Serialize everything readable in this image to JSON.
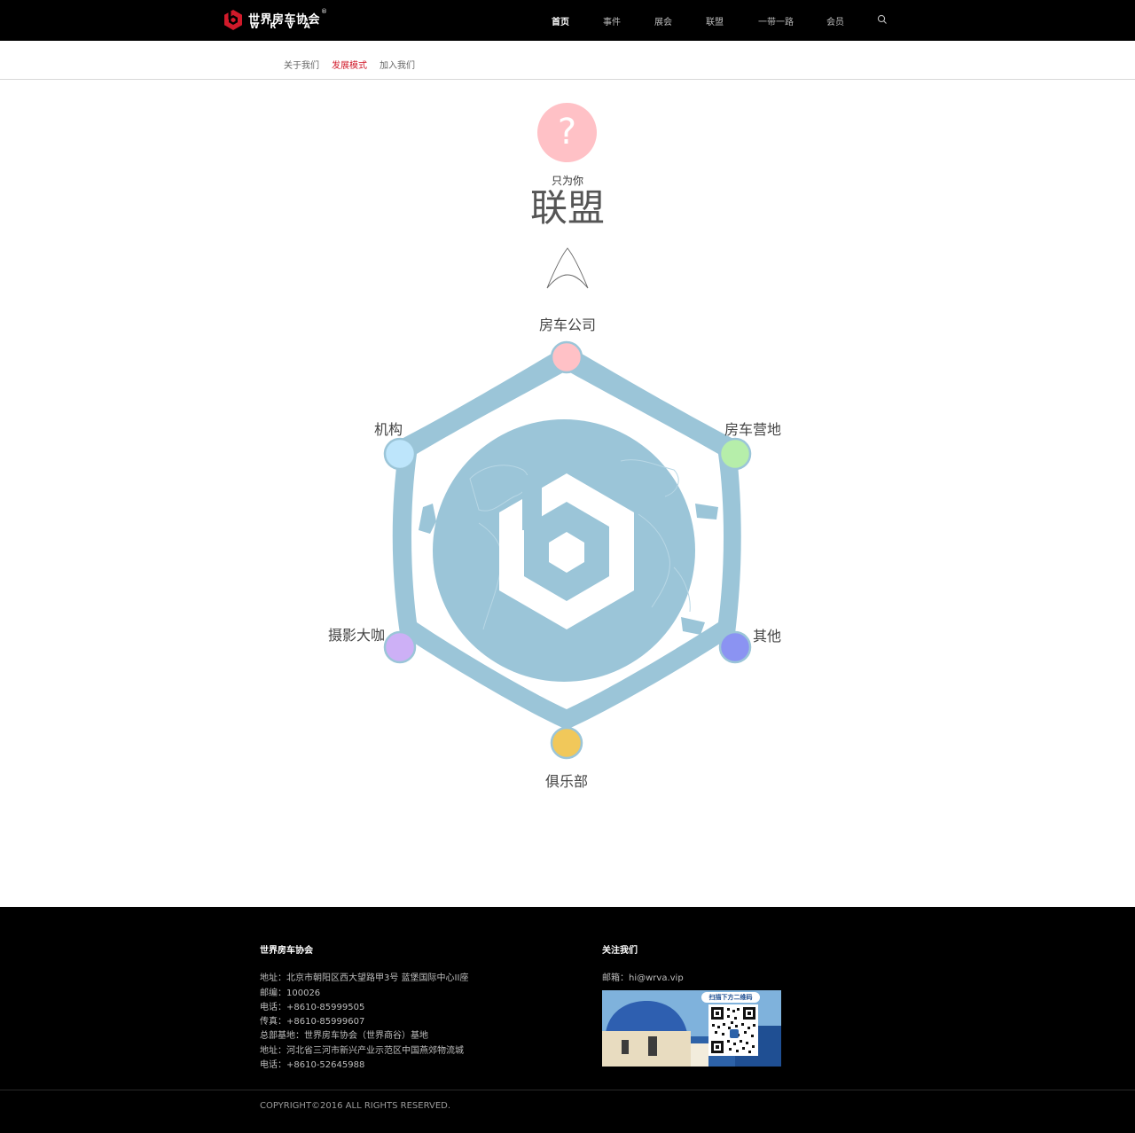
{
  "header": {
    "logo_cn": "世界房车协会",
    "logo_reg": "®",
    "logo_en": "WRVA",
    "nav": [
      {
        "label": "首页",
        "active": true
      },
      {
        "label": "事件"
      },
      {
        "label": "展会"
      },
      {
        "label": "联盟"
      },
      {
        "label": "一带一路"
      },
      {
        "label": "会员"
      }
    ]
  },
  "subnav": [
    {
      "label": "关于我们"
    },
    {
      "label": "发展模式",
      "active": true
    },
    {
      "label": "加入我们"
    }
  ],
  "hero": {
    "question_mark": "?",
    "subtitle": "只为你",
    "title": "联盟"
  },
  "diagram": {
    "nodes": [
      {
        "label": "房车公司",
        "color": "#ffc1c6"
      },
      {
        "label": "房车营地",
        "color": "#b6eeaa"
      },
      {
        "label": "其他",
        "color": "#8b93f2"
      },
      {
        "label": "俱乐部",
        "color": "#f1c85a"
      },
      {
        "label": "摄影大咖",
        "color": "#cdb0f6"
      },
      {
        "label": "机构",
        "color": "#bde5fb"
      }
    ],
    "frame_color": "#9bc5d8"
  },
  "footer": {
    "left_title": "世界房车协会",
    "lines": [
      "地址：北京市朝阳区西大望路甲3号 蓝堡国际中心II座",
      "邮编：100026",
      "电话：+8610-85999505",
      "传真：+8610-85999607",
      "总部基地：世界房车协会（世界商谷）基地",
      "地址：河北省三河市新兴产业示范区中国燕郊物流城",
      "电话：+8610-52645988"
    ],
    "right_title": "关注我们",
    "email": "邮箱：hi@wrva.vip",
    "qr_caption": "扫描下方二维码",
    "copyright": "COPYRIGHT©2016 ALL RIGHTS RESERVED."
  }
}
